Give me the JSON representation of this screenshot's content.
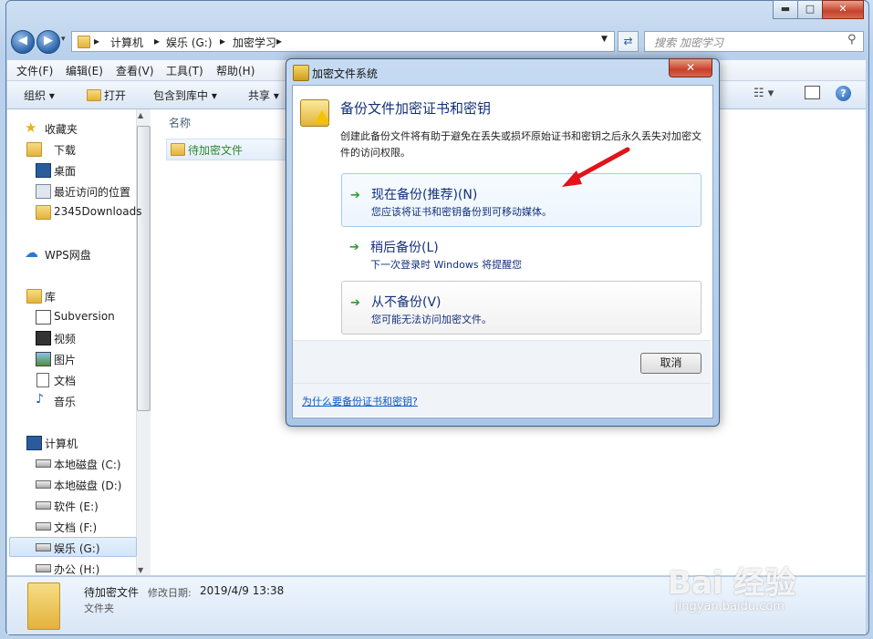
{
  "window": {
    "minimize": "▬",
    "maximize": "□",
    "close": "✕"
  },
  "address": {
    "path": [
      "计算机",
      "娱乐 (G:)",
      "加密学习"
    ]
  },
  "search": {
    "placeholder": "搜索 加密学习"
  },
  "menu": [
    "文件(F)",
    "编辑(E)",
    "查看(V)",
    "工具(T)",
    "帮助(H)"
  ],
  "toolbar": {
    "organize": "组织 ▾",
    "open": "打开",
    "include": "包含到库中 ▾",
    "share": "共享 ▾"
  },
  "sidebar": {
    "favorites": {
      "label": "收藏夹",
      "items": [
        "下载",
        "桌面",
        "最近访问的位置",
        "2345Downloads"
      ]
    },
    "wps": "WPS网盘",
    "libraries": {
      "label": "库",
      "items": [
        "Subversion",
        "视频",
        "图片",
        "文档",
        "音乐"
      ]
    },
    "computer": {
      "label": "计算机",
      "items": [
        "本地磁盘 (C:)",
        "本地磁盘 (D:)",
        "软件 (E:)",
        "文档 (F:)",
        "娱乐 (G:)",
        "办公 (H:)"
      ]
    }
  },
  "content": {
    "column_name": "名称",
    "folder": "待加密文件"
  },
  "details": {
    "name": "待加密文件",
    "modified_label": "修改日期:",
    "modified_value": "2019/4/9 13:38",
    "type": "文件夹"
  },
  "dialog": {
    "title": "加密文件系统",
    "close": "✕",
    "heading": "备份文件加密证书和密钥",
    "description": "创建此备份文件将有助于避免在丢失或损坏原始证书和密钥之后永久丢失对加密文件的访问权限。",
    "options": [
      {
        "title": "现在备份(推荐)(N)",
        "subtitle": "您应该将证书和密钥备份到可移动媒体。"
      },
      {
        "title": "稍后备份(L)",
        "subtitle": "下一次登录时 Windows 将提醒您"
      },
      {
        "title": "从不备份(V)",
        "subtitle": "您可能无法访问加密文件。"
      }
    ],
    "cancel": "取消",
    "help_link": "为什么要备份证书和密钥?"
  },
  "watermark": {
    "brand": "Bai 经验",
    "url": "jingyan.baidu.com"
  }
}
